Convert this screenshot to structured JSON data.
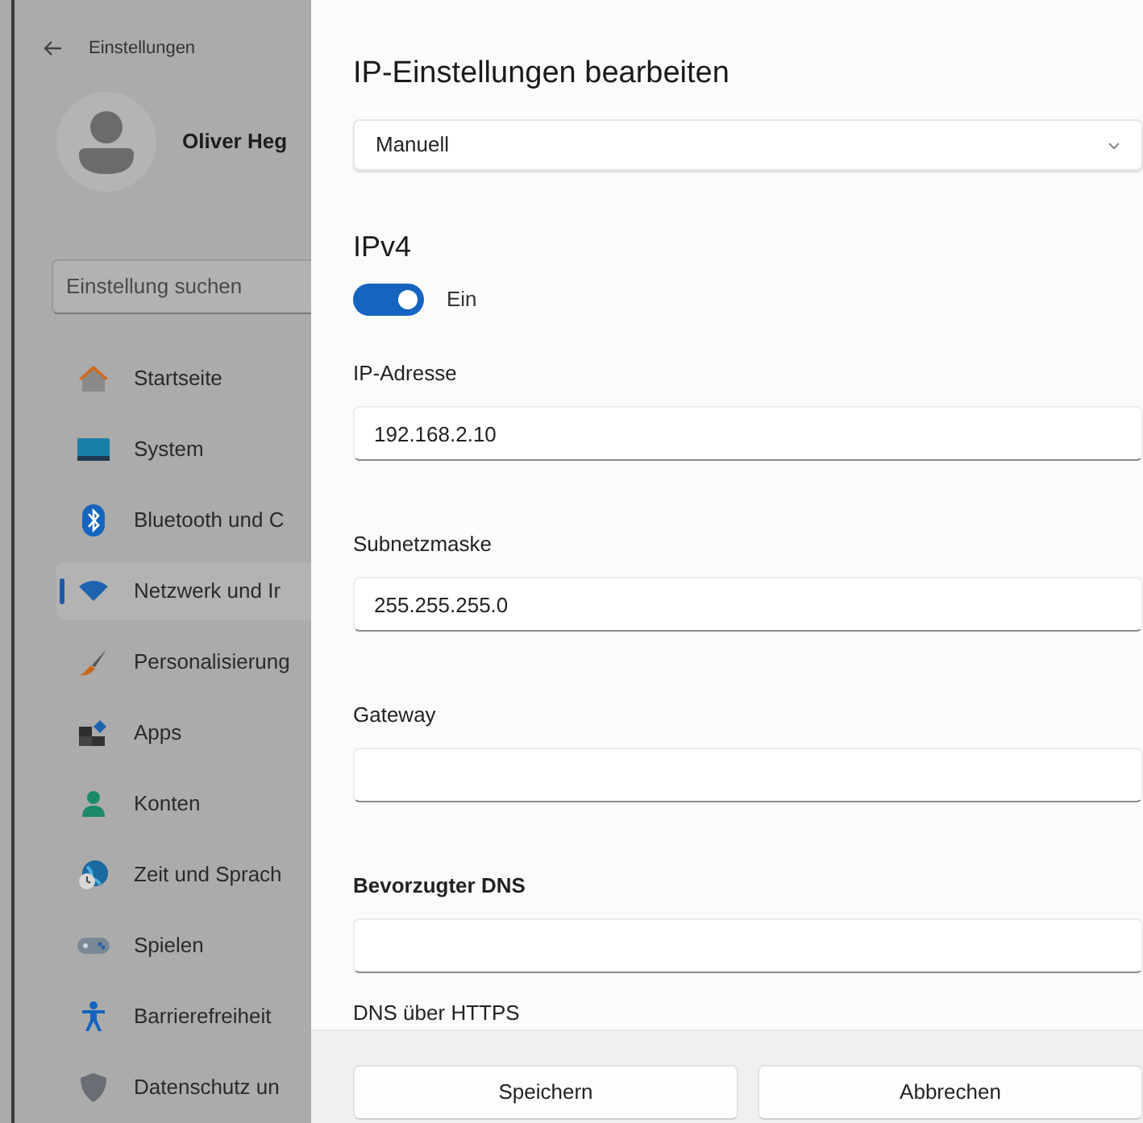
{
  "sidebar": {
    "title": "Einstellungen",
    "user": {
      "name": "Oliver Heg"
    },
    "search": {
      "placeholder": "Einstellung suchen"
    },
    "items": [
      {
        "label": "Startseite",
        "selected": false
      },
      {
        "label": "System",
        "selected": false
      },
      {
        "label": "Bluetooth und C",
        "selected": false
      },
      {
        "label": "Netzwerk und Ir",
        "selected": true
      },
      {
        "label": "Personalisierung",
        "selected": false
      },
      {
        "label": "Apps",
        "selected": false
      },
      {
        "label": "Konten",
        "selected": false
      },
      {
        "label": "Zeit und Sprach",
        "selected": false
      },
      {
        "label": "Spielen",
        "selected": false
      },
      {
        "label": "Barrierefreiheit",
        "selected": false
      },
      {
        "label": "Datenschutz un",
        "selected": false
      }
    ]
  },
  "dialog": {
    "title": "IP-Einstellungen bearbeiten",
    "mode": {
      "value": "Manuell"
    },
    "section": "IPv4",
    "toggle": {
      "on": true,
      "label": "Ein"
    },
    "fields": [
      {
        "label": "IP-Adresse",
        "value": "192.168.2.10",
        "bold": false
      },
      {
        "label": "Subnetzmaske",
        "value": "255.255.255.0",
        "bold": false
      },
      {
        "label": "Gateway",
        "bold": false
      },
      {
        "label": "Bevorzugter DNS",
        "bold": true
      }
    ],
    "dns_over_https": "DNS über HTTPS",
    "buttons": [
      "Speichern",
      "Abbrechen"
    ]
  }
}
